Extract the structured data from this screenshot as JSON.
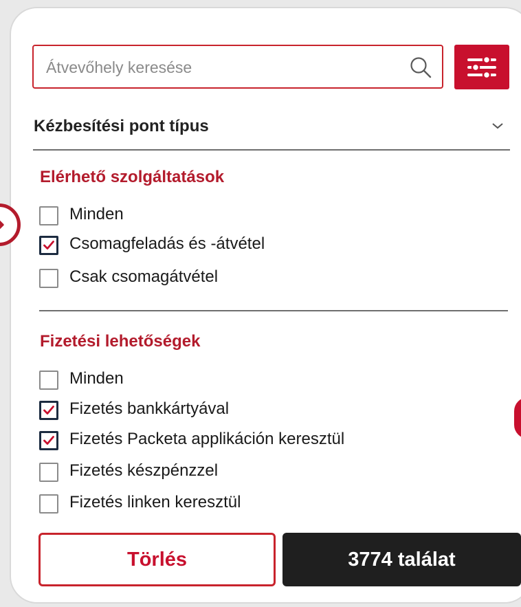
{
  "search": {
    "placeholder": "Átvevőhely keresése"
  },
  "delivery_type": {
    "title": "Kézbesítési pont típus"
  },
  "services": {
    "title": "Elérhető szolgáltatások",
    "options": [
      {
        "label": "Minden",
        "checked": false
      },
      {
        "label": "Csomagfeladás és -átvétel",
        "checked": true
      },
      {
        "label": "Csak csomagátvétel",
        "checked": false
      }
    ]
  },
  "payment": {
    "title": "Fizetési lehetőségek",
    "options": [
      {
        "label": "Minden",
        "checked": false
      },
      {
        "label": "Fizetés bankkártyával",
        "checked": true
      },
      {
        "label": "Fizetés Packeta applikáción keresztül",
        "checked": true
      },
      {
        "label": "Fizetés készpénzzel",
        "checked": false
      },
      {
        "label": "Fizetés linken keresztül",
        "checked": false
      }
    ]
  },
  "buttons": {
    "clear": "Törlés",
    "results": "3774 találat"
  },
  "icons": {
    "search": "search-icon",
    "filter": "sliders-icon",
    "chevron": "chevron-down-icon",
    "check": "checkmark-icon",
    "arrow": "arrow-right-icon"
  },
  "colors": {
    "accent": "#c8102e",
    "dark": "#1f1f1f",
    "checkbox_border": "#1c2b40"
  }
}
